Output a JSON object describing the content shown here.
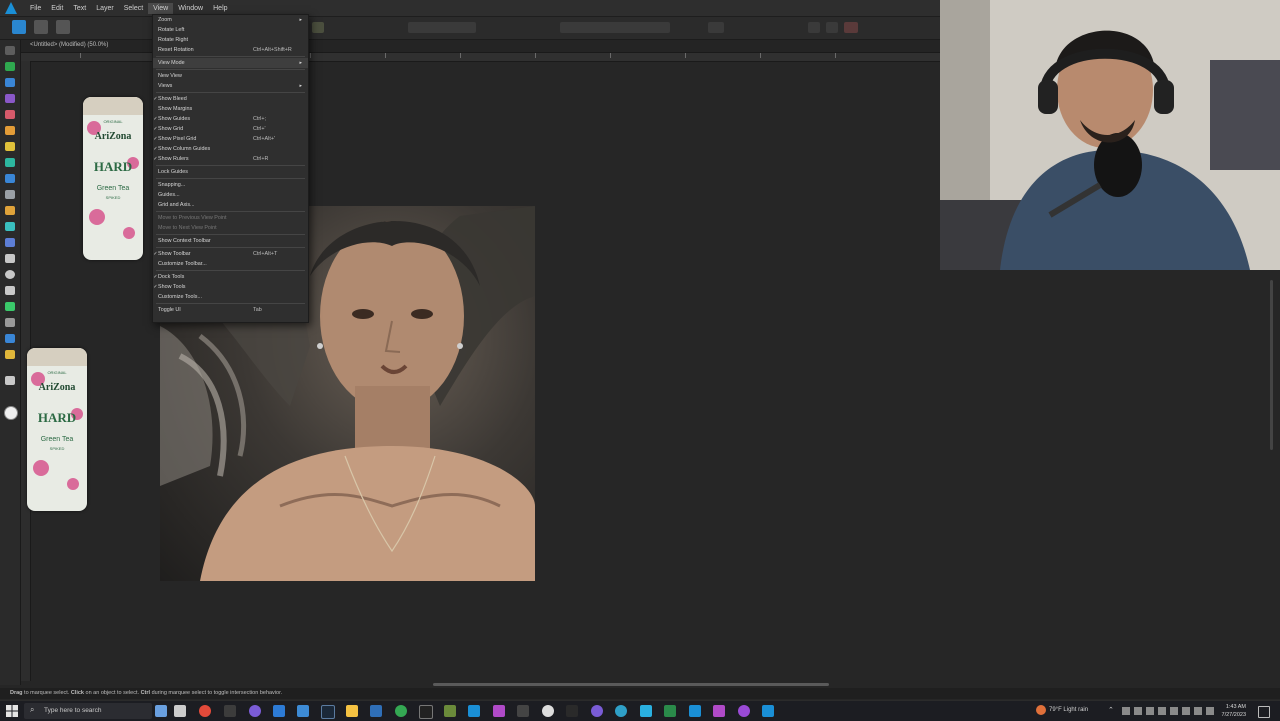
{
  "menubar": {
    "items": [
      "File",
      "Edit",
      "Text",
      "Layer",
      "Select",
      "View",
      "Window",
      "Help"
    ],
    "active_index": 5
  },
  "document": {
    "title": "<Untitled> (Modified) (50.0%)"
  },
  "view_menu": {
    "items": [
      {
        "label": "Zoom",
        "submenu": true
      },
      {
        "label": "Rotate Left"
      },
      {
        "label": "Rotate Right"
      },
      {
        "label": "Reset Rotation",
        "shortcut": "Ctrl+Alt+Shift+R"
      },
      {
        "sep": true
      },
      {
        "label": "View Mode",
        "submenu": true
      },
      {
        "sep": true
      },
      {
        "label": "New View"
      },
      {
        "label": "Views",
        "submenu": true
      },
      {
        "sep": true
      },
      {
        "label": "Show Bleed",
        "checked": true
      },
      {
        "label": "Show Margins"
      },
      {
        "label": "Show Guides",
        "checked": true,
        "shortcut": "Ctrl+;"
      },
      {
        "label": "Show Grid",
        "checked": true,
        "shortcut": "Ctrl+'"
      },
      {
        "label": "Show Pixel Grid",
        "checked": true,
        "shortcut": "Ctrl+Alt+'"
      },
      {
        "label": "Show Column Guides",
        "checked": true
      },
      {
        "label": "Show Rulers",
        "checked": true,
        "shortcut": "Ctrl+R"
      },
      {
        "sep": true
      },
      {
        "label": "Lock Guides"
      },
      {
        "sep": true
      },
      {
        "label": "Snapping..."
      },
      {
        "label": "Guides..."
      },
      {
        "label": "Grid and Axis..."
      },
      {
        "sep": true
      },
      {
        "label": "Move to Previous View Point",
        "disabled": true
      },
      {
        "label": "Move to Next View Point",
        "disabled": true
      },
      {
        "sep": true
      },
      {
        "label": "Show Context Toolbar"
      },
      {
        "sep": true
      },
      {
        "label": "Show Toolbar",
        "checked": true,
        "shortcut": "Ctrl+Alt+T"
      },
      {
        "label": "Customize Toolbar..."
      },
      {
        "sep": true
      },
      {
        "label": "Dock Tools",
        "checked": true
      },
      {
        "label": "Show Tools",
        "checked": true
      },
      {
        "label": "Customize Tools..."
      },
      {
        "sep": true
      },
      {
        "label": "Toggle UI",
        "shortcut": "Tab"
      }
    ]
  },
  "can": {
    "brand": "AriZona",
    "line1": "ORIGINAL",
    "line2": "HARD",
    "line3": "Green Tea",
    "line4": "SPIKED"
  },
  "statusbar": {
    "text_bold1": "Drag",
    "text1": " to marquee select. ",
    "text_bold2": "Click",
    "text2": " on an object to select. ",
    "text_bold3": "Ctrl",
    "text3": " during marquee select to toggle intersection behavior."
  },
  "taskbar": {
    "search_placeholder": "Type here to search",
    "weather": "79°F Light rain",
    "time": "1:43 AM",
    "date": "7/27/2023"
  },
  "colors": {
    "accent": "#1a8fd6",
    "menu_bg": "#2f2f2f",
    "app_bg": "#262626"
  }
}
